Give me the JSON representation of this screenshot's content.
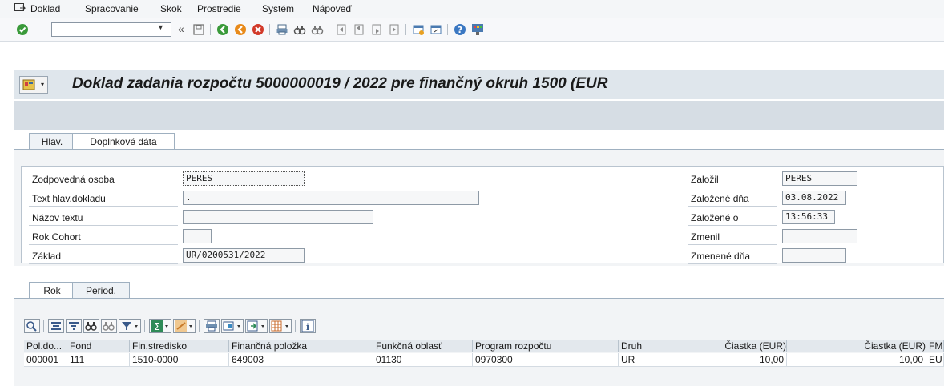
{
  "menu": {
    "items": [
      "Doklad",
      "Spracovanie",
      "Skok",
      "Prostredie",
      "Systém",
      "Nápoveď"
    ]
  },
  "toolbar": {
    "command_value": "",
    "icons": [
      "enter-icon",
      "back-icon",
      "save-icon",
      "back-green-icon",
      "exit-icon",
      "cancel-icon",
      "print-icon",
      "find-icon",
      "find-next-icon",
      "first-page-icon",
      "prev-page-icon",
      "next-page-icon",
      "last-page-icon",
      "new-session-icon",
      "shortcut-icon",
      "help-icon",
      "customize-layout-icon"
    ]
  },
  "title": "Doklad zadania rozpočtu 5000000019 / 2022 pre finančný okruh 1500 (EUR",
  "header_tabs": [
    "Hlav.",
    "Doplnkové dáta"
  ],
  "header_fields": {
    "zodpovedna_osoba": {
      "label": "Zodpovedná osoba",
      "value": "PERES"
    },
    "text_hlav_dokladu": {
      "label": "Text hlav.dokladu",
      "value": "."
    },
    "nazov_textu": {
      "label": "Názov textu",
      "value": ""
    },
    "rok_cohort": {
      "label": "Rok Cohort",
      "value": ""
    },
    "zaklad": {
      "label": "Základ",
      "value": "UR/0200531/2022"
    },
    "zalozil": {
      "label": "Založil",
      "value": "PERES"
    },
    "zalozene_dna": {
      "label": "Založené dňa",
      "value": "03.08.2022"
    },
    "zalozene_o": {
      "label": "Založené o",
      "value": "13:56:33"
    },
    "zmenil": {
      "label": "Zmenil",
      "value": ""
    },
    "zmenene_dna": {
      "label": "Zmenené dňa",
      "value": ""
    }
  },
  "item_tabs": [
    "Rok",
    "Period."
  ],
  "grid": {
    "columns": [
      "Pol.do...",
      "Fond",
      "Fin.stredisko",
      "Finančná položka",
      "Funkčná oblasť",
      "Program rozpočtu",
      "Druh",
      "Čiastka (EUR)",
      "Čiastka (EUR)",
      "FM"
    ],
    "rows": [
      [
        "000001",
        "111",
        "1510-0000",
        "649003",
        "01130",
        "0970300",
        "UR",
        "10,00",
        "10,00",
        "EU"
      ]
    ]
  },
  "colors": {
    "title_bar": "#dfe6ec",
    "panel": "#f2f4f6",
    "accent_green": "#3a9a3a",
    "accent_orange": "#e88a1a",
    "accent_red": "#d23a2a"
  }
}
